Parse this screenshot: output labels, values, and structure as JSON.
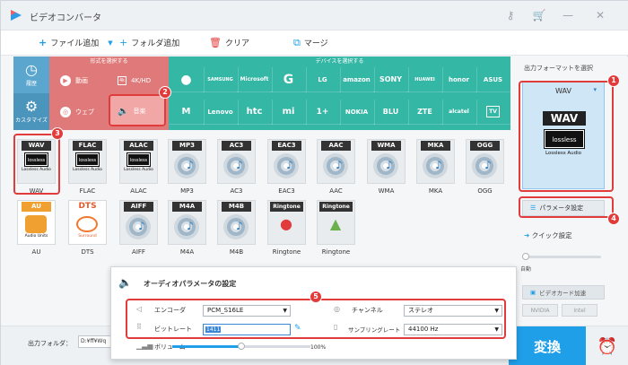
{
  "app": {
    "title": "ビデオコンバータ"
  },
  "toolbar": {
    "add_file": "ファイル追加",
    "add_folder": "フォルダ追加",
    "clear": "クリア",
    "merge": "マージ"
  },
  "categories": {
    "left": [
      {
        "label": "履歴",
        "icon": "history-icon"
      },
      {
        "label": "カスタマイズ",
        "icon": "customize-icon"
      }
    ],
    "format_header": "形式を選択する",
    "formats": [
      {
        "label": "動画",
        "icon": "play-icon"
      },
      {
        "label": "4K/HD",
        "icon": "4k-icon"
      },
      {
        "label": "ウェブ",
        "icon": "chrome-icon"
      },
      {
        "label": "音楽",
        "icon": "speaker-icon"
      }
    ],
    "device_header": "デバイスを選択する",
    "devices_row1": [
      "",
      "SAMSUNG",
      "Microsoft",
      "G",
      "LG",
      "amazon",
      "SONY",
      "HUAWEI",
      "honor",
      "ASUS"
    ],
    "devices_row2": [
      "M",
      "Lenovo",
      "htc",
      "mi",
      "1+",
      "NOKIA",
      "BLU",
      "ZTE",
      "alcatel",
      "TV"
    ]
  },
  "formats": {
    "row1": [
      "WAV",
      "FLAC",
      "ALAC",
      "MP3",
      "AC3",
      "EAC3",
      "AAC",
      "WMA",
      "MKA",
      "OGG"
    ],
    "row2": [
      "AU",
      "DTS",
      "AIFF",
      "M4A",
      "M4B",
      "Ringtone",
      "Ringtone"
    ],
    "lossless_badge": "lossless",
    "lossless_caption": "Lossless Audio",
    "au_caption": "Audio Units",
    "dts_caption": "Surround"
  },
  "right_panel": {
    "output_format_label": "出力フォーマットを選択",
    "selected_format": "WAV",
    "badge_big": "WAV",
    "badge_lossless": "lossless",
    "badge_caption": "Lossless Audio",
    "param_button": "パラメータ設定",
    "quick_settings": "クイック設定",
    "auto_label": "自動",
    "gpu_label": "ビデオカード加速",
    "chips": [
      "NVIDIA",
      "Intel"
    ]
  },
  "audio_params": {
    "title": "オーディオパラメータの設定",
    "encoder_label": "エンコーダ",
    "encoder_value": "PCM_S16LE",
    "bitrate_label": "ビットレート",
    "bitrate_value": "1411",
    "channel_label": "チャンネル",
    "channel_value": "ステレオ",
    "samplerate_label": "サンプリングレート",
    "samplerate_value": "44100 Hz",
    "volume_label": "ボリューム",
    "volume_value": "100%",
    "volume_level": 0.5
  },
  "bottom": {
    "output_folder_label": "出力フォルダ：",
    "output_folder_value": "D:¥ff¥Wq",
    "convert_label": "変換"
  },
  "annotations": [
    "1",
    "2",
    "3",
    "4",
    "5"
  ],
  "colors": {
    "accent": "#1f9fe8",
    "annotation_red": "#e23b3b",
    "format_category": "#e07a7a",
    "device_category": "#35b7a6",
    "history_category": "#5aa6cf"
  }
}
